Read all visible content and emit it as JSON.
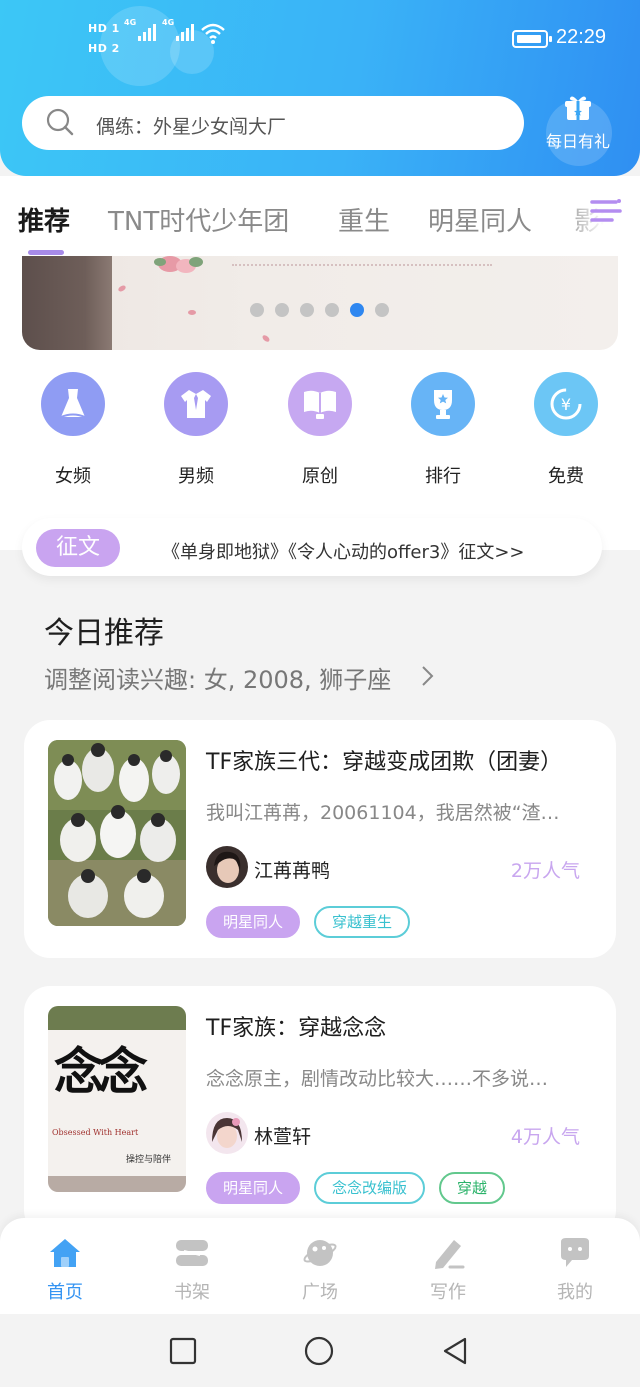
{
  "status_bar": {
    "hd1": "HD 1",
    "hd2": "HD 2",
    "net1": "4G",
    "net2": "4G",
    "time": "22:29"
  },
  "search": {
    "placeholder": "偶练：外星少女闯大厂",
    "icon": "search-icon"
  },
  "gift": {
    "label": "每日有礼",
    "icon": "gift-icon"
  },
  "tabs": [
    {
      "label": "推荐",
      "active": true
    },
    {
      "label": "TNT时代少年团"
    },
    {
      "label": "重生"
    },
    {
      "label": "明星同人"
    },
    {
      "label": "影视"
    }
  ],
  "banner": {
    "total_slides": 6,
    "active_index": 4
  },
  "categories": [
    {
      "label": "女频",
      "icon": "dress-icon",
      "color": "#8f9cf3"
    },
    {
      "label": "男频",
      "icon": "shirt-icon",
      "color": "#a79bf2"
    },
    {
      "label": "原创",
      "icon": "book-icon",
      "color": "#c6a8f1"
    },
    {
      "label": "排行",
      "icon": "trophy-icon",
      "color": "#67b4f6"
    },
    {
      "label": "免费",
      "icon": "coin-icon",
      "color": "#6cc6f5"
    }
  ],
  "notice": {
    "badge": "征文",
    "text": "《单身即地狱》《令人心动的offer3》征文>>"
  },
  "today": {
    "title": "今日推荐",
    "subtitle": "调整阅读兴趣: 女, 2008, 狮子座"
  },
  "books": [
    {
      "title": "TF家族三代：穿越变成团欺（团妻）",
      "desc": "我叫江苒苒，20061104，我居然被“渣…",
      "author": "江苒苒鸭",
      "popularity": "2万人气",
      "tags": [
        {
          "label": "明星同人",
          "style": "fill"
        },
        {
          "label": "穿越重生",
          "style": "teal"
        }
      ]
    },
    {
      "title": "TF家族：穿越念念",
      "desc": "念念原主，剧情改动比较大……不多说…",
      "author": "林萱轩",
      "popularity": "4万人气",
      "cover_text": "念念",
      "cover_sub": "Obsessed With Heart",
      "cover_sub2": "操控与陪伴",
      "tags": [
        {
          "label": "明星同人",
          "style": "fill"
        },
        {
          "label": "念念改编版",
          "style": "teal"
        },
        {
          "label": "穿越",
          "style": "green"
        }
      ]
    }
  ],
  "bottom_nav": [
    {
      "label": "首页",
      "icon": "home-icon",
      "active": true
    },
    {
      "label": "书架",
      "icon": "bookshelf-icon"
    },
    {
      "label": "广场",
      "icon": "planet-icon"
    },
    {
      "label": "写作",
      "icon": "pen-icon"
    },
    {
      "label": "我的",
      "icon": "chat-bubble-icon"
    }
  ],
  "colors": {
    "header_gradient_start": "#3cc7f6",
    "header_gradient_end": "#2f8ff2",
    "accent_purple": "#c9a4f0",
    "active_blue": "#3594f2"
  }
}
